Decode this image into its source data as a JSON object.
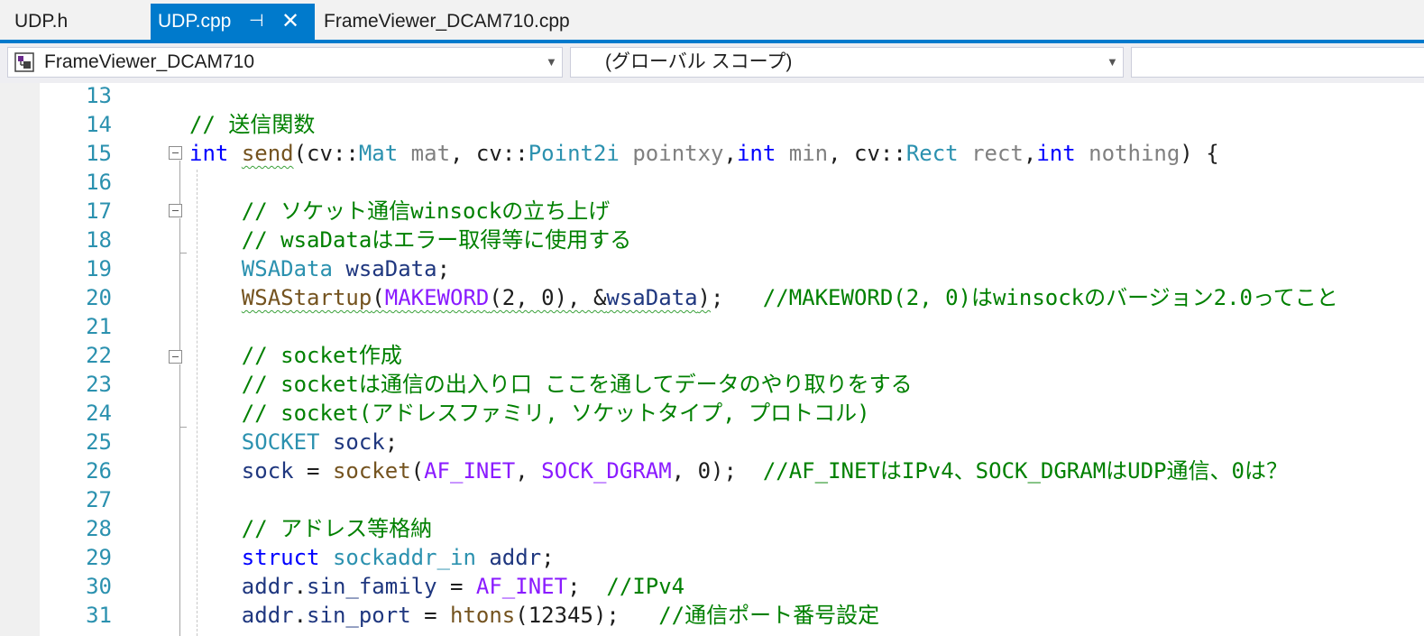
{
  "tabs": [
    {
      "label": "UDP.h",
      "active": false
    },
    {
      "label": "UDP.cpp",
      "active": true
    },
    {
      "label": "FrameViewer_DCAM710.cpp",
      "active": false
    }
  ],
  "navbar": {
    "project": "FrameViewer_DCAM710",
    "scope": "(グローバル スコープ)",
    "member": ""
  },
  "colors": {
    "accent": "#007acc",
    "keyword": "#0000ff",
    "type": "#2b91af",
    "comment": "#008000",
    "function": "#74531f",
    "macro": "#8a1bff",
    "parameter": "#808080",
    "local": "#1f377f"
  },
  "editor": {
    "line_numbers": [
      "13",
      "14",
      "15",
      "16",
      "17",
      "18",
      "19",
      "20",
      "21",
      "22",
      "23",
      "24",
      "25",
      "26",
      "27",
      "28",
      "29",
      "30",
      "31"
    ],
    "lines": [
      {
        "tokens": []
      },
      {
        "tokens": [
          {
            "t": "// 送信関数",
            "c": "cm"
          }
        ]
      },
      {
        "tokens": [
          {
            "t": "int",
            "c": "kw"
          },
          {
            "t": " "
          },
          {
            "t": "send",
            "c": "fn",
            "u": true
          },
          {
            "t": "(cv::"
          },
          {
            "t": "Mat",
            "c": "ty"
          },
          {
            "t": " "
          },
          {
            "t": "mat",
            "c": "pr"
          },
          {
            "t": ", cv::"
          },
          {
            "t": "Point2i",
            "c": "ty"
          },
          {
            "t": " "
          },
          {
            "t": "pointxy",
            "c": "pr"
          },
          {
            "t": ","
          },
          {
            "t": "int",
            "c": "kw"
          },
          {
            "t": " "
          },
          {
            "t": "min",
            "c": "pr"
          },
          {
            "t": ", cv::"
          },
          {
            "t": "Rect",
            "c": "ty"
          },
          {
            "t": " "
          },
          {
            "t": "rect",
            "c": "pr"
          },
          {
            "t": ","
          },
          {
            "t": "int",
            "c": "kw"
          },
          {
            "t": " "
          },
          {
            "t": "nothing",
            "c": "pr"
          },
          {
            "t": ") {"
          }
        ]
      },
      {
        "tokens": []
      },
      {
        "tokens": [
          {
            "t": "    // ソケット通信winsockの立ち上げ",
            "c": "cm"
          }
        ]
      },
      {
        "tokens": [
          {
            "t": "    // wsaDataはエラー取得等に使用する",
            "c": "cm"
          }
        ]
      },
      {
        "tokens": [
          {
            "t": "    "
          },
          {
            "t": "WSAData",
            "c": "ty"
          },
          {
            "t": " "
          },
          {
            "t": "wsaData",
            "c": "nm"
          },
          {
            "t": ";"
          }
        ]
      },
      {
        "tokens": [
          {
            "t": "    "
          },
          {
            "t": "WSAStartup",
            "c": "fn",
            "u": true
          },
          {
            "t": "(",
            "u": true
          },
          {
            "t": "MAKEWORD",
            "c": "mac",
            "u": true
          },
          {
            "t": "(2, 0), &",
            "u": true
          },
          {
            "t": "wsaData",
            "c": "nm",
            "u": true
          },
          {
            "t": ")",
            "u": true
          },
          {
            "t": ";   "
          },
          {
            "t": "//MAKEWORD(2, 0)はwinsockのバージョン2.0ってこと",
            "c": "cm"
          }
        ]
      },
      {
        "tokens": []
      },
      {
        "tokens": [
          {
            "t": "    // socket作成",
            "c": "cm"
          }
        ]
      },
      {
        "tokens": [
          {
            "t": "    // socketは通信の出入り口 ここを通してデータのやり取りをする",
            "c": "cm"
          }
        ]
      },
      {
        "tokens": [
          {
            "t": "    // socket(アドレスファミリ, ソケットタイプ, プロトコル)",
            "c": "cm"
          }
        ]
      },
      {
        "tokens": [
          {
            "t": "    "
          },
          {
            "t": "SOCKET",
            "c": "ty"
          },
          {
            "t": " "
          },
          {
            "t": "sock",
            "c": "nm"
          },
          {
            "t": ";"
          }
        ]
      },
      {
        "tokens": [
          {
            "t": "    "
          },
          {
            "t": "sock",
            "c": "nm"
          },
          {
            "t": " = "
          },
          {
            "t": "socket",
            "c": "fn"
          },
          {
            "t": "("
          },
          {
            "t": "AF_INET",
            "c": "mac"
          },
          {
            "t": ", "
          },
          {
            "t": "SOCK_DGRAM",
            "c": "mac"
          },
          {
            "t": ", 0);  "
          },
          {
            "t": "//AF_INETはIPv4、SOCK_DGRAMはUDP通信、0は？",
            "c": "cm"
          }
        ]
      },
      {
        "tokens": []
      },
      {
        "tokens": [
          {
            "t": "    // アドレス等格納",
            "c": "cm"
          }
        ]
      },
      {
        "tokens": [
          {
            "t": "    "
          },
          {
            "t": "struct",
            "c": "kw"
          },
          {
            "t": " "
          },
          {
            "t": "sockaddr_in",
            "c": "ty"
          },
          {
            "t": " "
          },
          {
            "t": "addr",
            "c": "nm"
          },
          {
            "t": ";"
          }
        ]
      },
      {
        "tokens": [
          {
            "t": "    "
          },
          {
            "t": "addr",
            "c": "nm"
          },
          {
            "t": "."
          },
          {
            "t": "sin_family",
            "c": "nm"
          },
          {
            "t": " = "
          },
          {
            "t": "AF_INET",
            "c": "mac"
          },
          {
            "t": ";  "
          },
          {
            "t": "//IPv4",
            "c": "cm"
          }
        ]
      },
      {
        "tokens": [
          {
            "t": "    "
          },
          {
            "t": "addr",
            "c": "nm"
          },
          {
            "t": "."
          },
          {
            "t": "sin_port",
            "c": "nm"
          },
          {
            "t": " = "
          },
          {
            "t": "htons",
            "c": "fn"
          },
          {
            "t": "(12345);   "
          },
          {
            "t": "//通信ポート番号設定",
            "c": "cm"
          }
        ]
      }
    ]
  }
}
